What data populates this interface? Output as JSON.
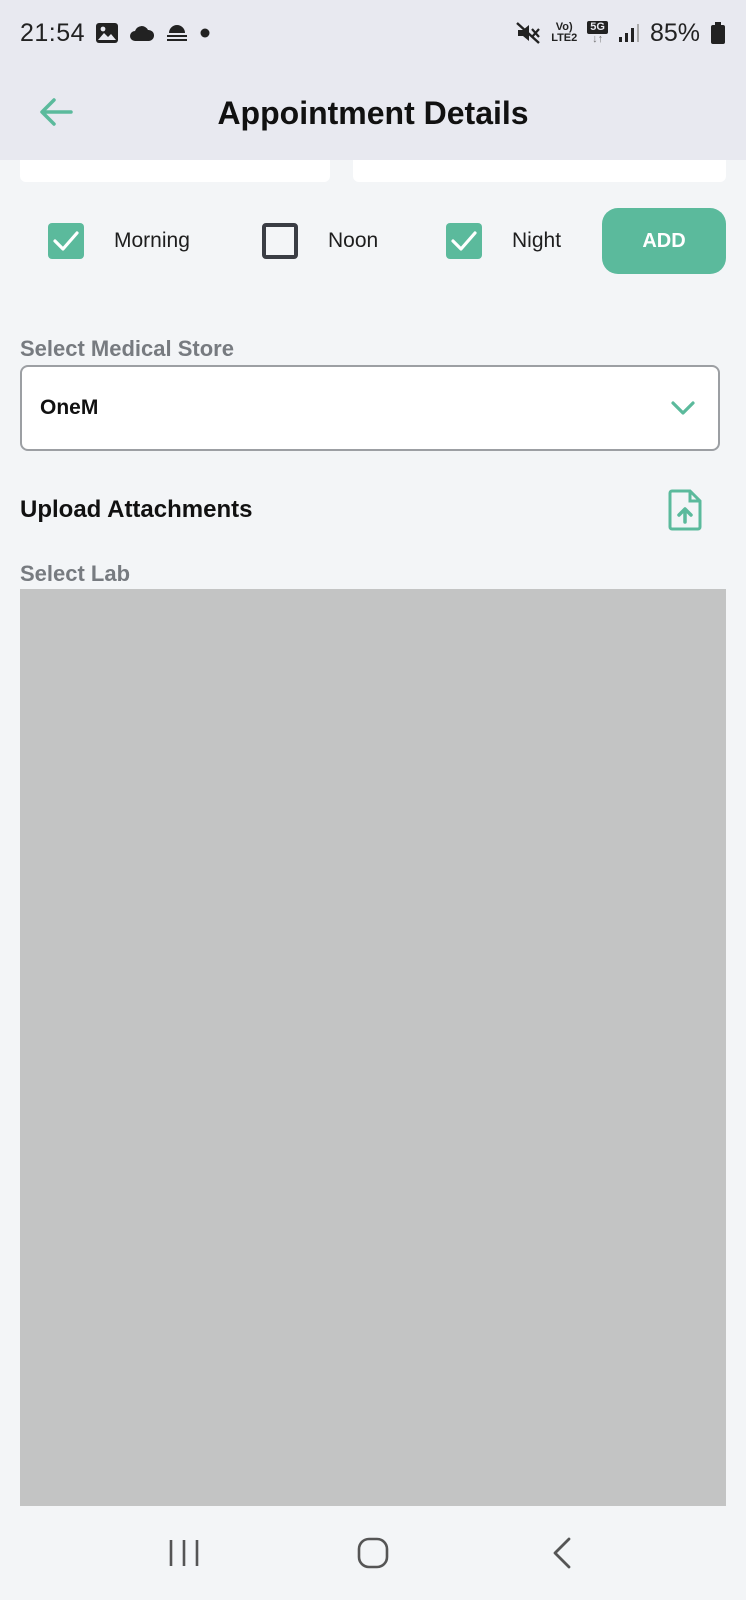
{
  "status_bar": {
    "time": "21:54",
    "battery_percent": "85%",
    "network_vo": "Vo)",
    "network_lte": "LTE2",
    "network_5g": "5G"
  },
  "app_bar": {
    "title": "Appointment Details"
  },
  "timing": {
    "morning_label": "Morning",
    "morning_checked": true,
    "noon_label": "Noon",
    "noon_checked": false,
    "night_label": "Night",
    "night_checked": true,
    "add_label": "ADD"
  },
  "medical_store": {
    "label": "Select Medical Store",
    "selected": "OneM"
  },
  "upload": {
    "title": "Upload Attachments"
  },
  "lab": {
    "label": "Select Lab"
  },
  "colors": {
    "accent": "#5bba9c",
    "header_bg": "#e8e9f0",
    "page_bg": "#f3f5f7",
    "placeholder_gray": "#c3c4c4"
  }
}
